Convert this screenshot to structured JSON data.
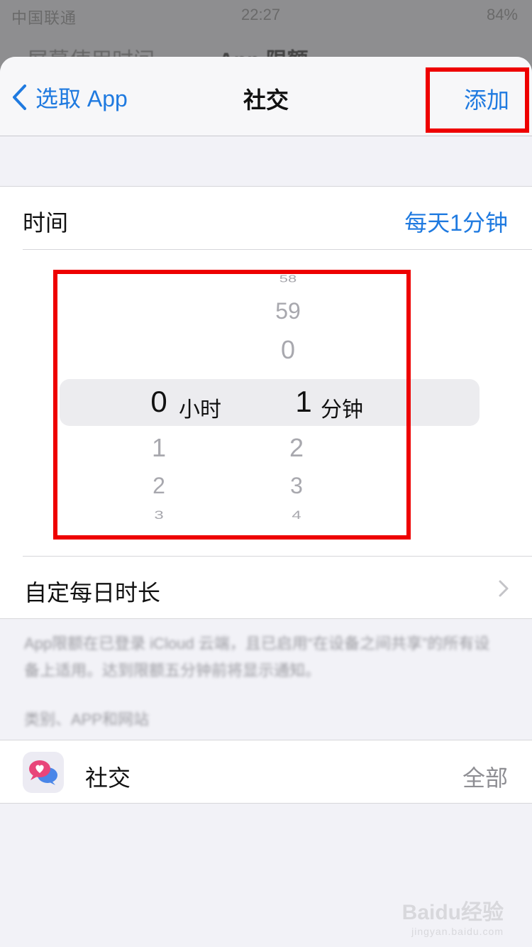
{
  "status_bar": {
    "carrier": "中国联通",
    "time": "22:27",
    "battery": "84%"
  },
  "background_nav": {
    "back_label": "屏幕使用时间",
    "title": "App 限额"
  },
  "nav": {
    "back_label": "选取 App",
    "title": "社交",
    "add_label": "添加"
  },
  "time_row": {
    "label": "时间",
    "value": "每天1分钟"
  },
  "picker": {
    "hours": {
      "above": [],
      "selected": "0",
      "below": [
        "1",
        "2",
        "3"
      ],
      "unit": "小时"
    },
    "minutes": {
      "above": [
        "58",
        "59",
        "0"
      ],
      "selected": "1",
      "below": [
        "2",
        "3",
        "4"
      ],
      "unit": "分钟"
    }
  },
  "custom_row": {
    "label": "自定每日时长"
  },
  "footnote": "App限额在已登录 iCloud 云端，且已启用“在设备之间共享”的所有设备上适用。达到限额五分钟前将显示通知。",
  "section_header": "类别、APP和网站",
  "category": {
    "name": "社交",
    "value": "全部"
  },
  "watermark": {
    "brand": "Baidu经验",
    "url": "jingyan.baidu.com"
  },
  "colors": {
    "accent": "#1f7ae0",
    "annotation": "#ee0000"
  },
  "icons": [
    "chevron-left-icon",
    "chevron-right-icon",
    "social-app-icon"
  ]
}
